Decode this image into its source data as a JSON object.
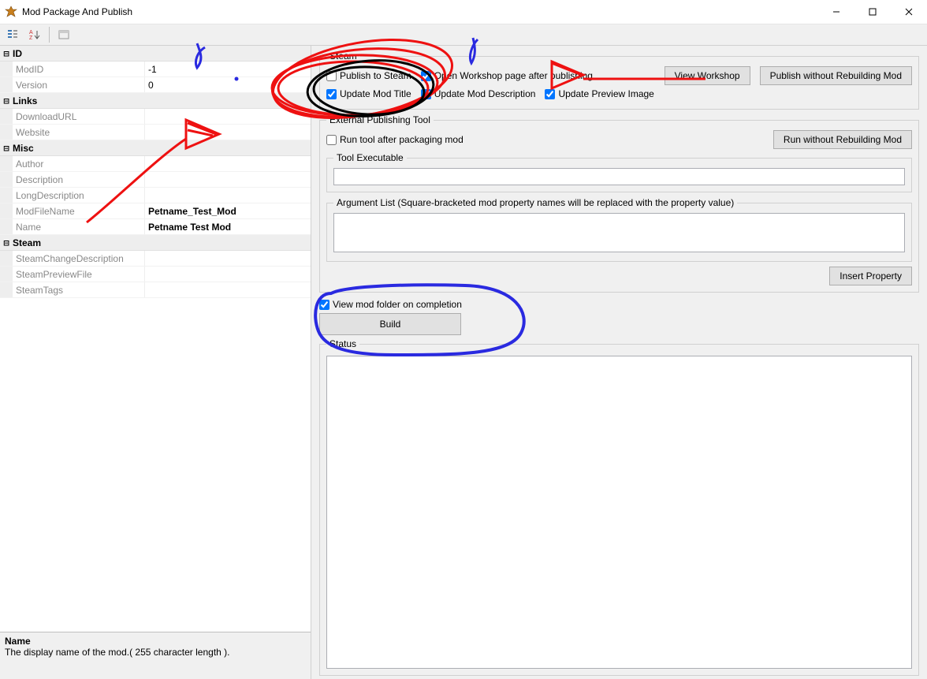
{
  "window": {
    "title": "Mod Package And Publish"
  },
  "propgrid": {
    "cats": [
      {
        "name": "ID",
        "rows": [
          {
            "key": "ModID",
            "val": "-1"
          },
          {
            "key": "Version",
            "val": "0"
          }
        ]
      },
      {
        "name": "Links",
        "rows": [
          {
            "key": "DownloadURL",
            "val": ""
          },
          {
            "key": "Website",
            "val": ""
          }
        ]
      },
      {
        "name": "Misc",
        "rows": [
          {
            "key": "Author",
            "val": ""
          },
          {
            "key": "Description",
            "val": ""
          },
          {
            "key": "LongDescription",
            "val": ""
          },
          {
            "key": "ModFileName",
            "val": "Petname_Test_Mod",
            "bold": true
          },
          {
            "key": "Name",
            "val": "Petname Test Mod",
            "bold": true
          }
        ]
      },
      {
        "name": "Steam",
        "rows": [
          {
            "key": "SteamChangeDescription",
            "val": ""
          },
          {
            "key": "SteamPreviewFile",
            "val": ""
          },
          {
            "key": "SteamTags",
            "val": ""
          }
        ]
      }
    ],
    "help": {
      "name": "Name",
      "desc": "The display name of the mod.( 255 character length )."
    }
  },
  "steam": {
    "legend": "Steam",
    "publish_to_steam": "Publish to Steam",
    "open_workshop_after": "Open Workshop page after publishing",
    "view_workshop_btn": "View Workshop",
    "publish_without_rebuild_btn": "Publish without Rebuilding Mod",
    "update_mod_title": "Update Mod Title",
    "update_mod_desc": "Update Mod Description",
    "update_preview_img": "Update Preview Image"
  },
  "ext": {
    "legend": "External Publishing Tool",
    "run_tool_after": "Run tool after packaging mod",
    "run_without_rebuild_btn": "Run without Rebuilding Mod",
    "tool_exec_legend": "Tool Executable",
    "arg_list_legend": "Argument List (Square-bracketed mod property names will be replaced with the property value)",
    "insert_property_btn": "Insert Property"
  },
  "build": {
    "view_folder": "View mod folder on completion",
    "build_btn": "Build"
  },
  "status": {
    "legend": "Status"
  }
}
